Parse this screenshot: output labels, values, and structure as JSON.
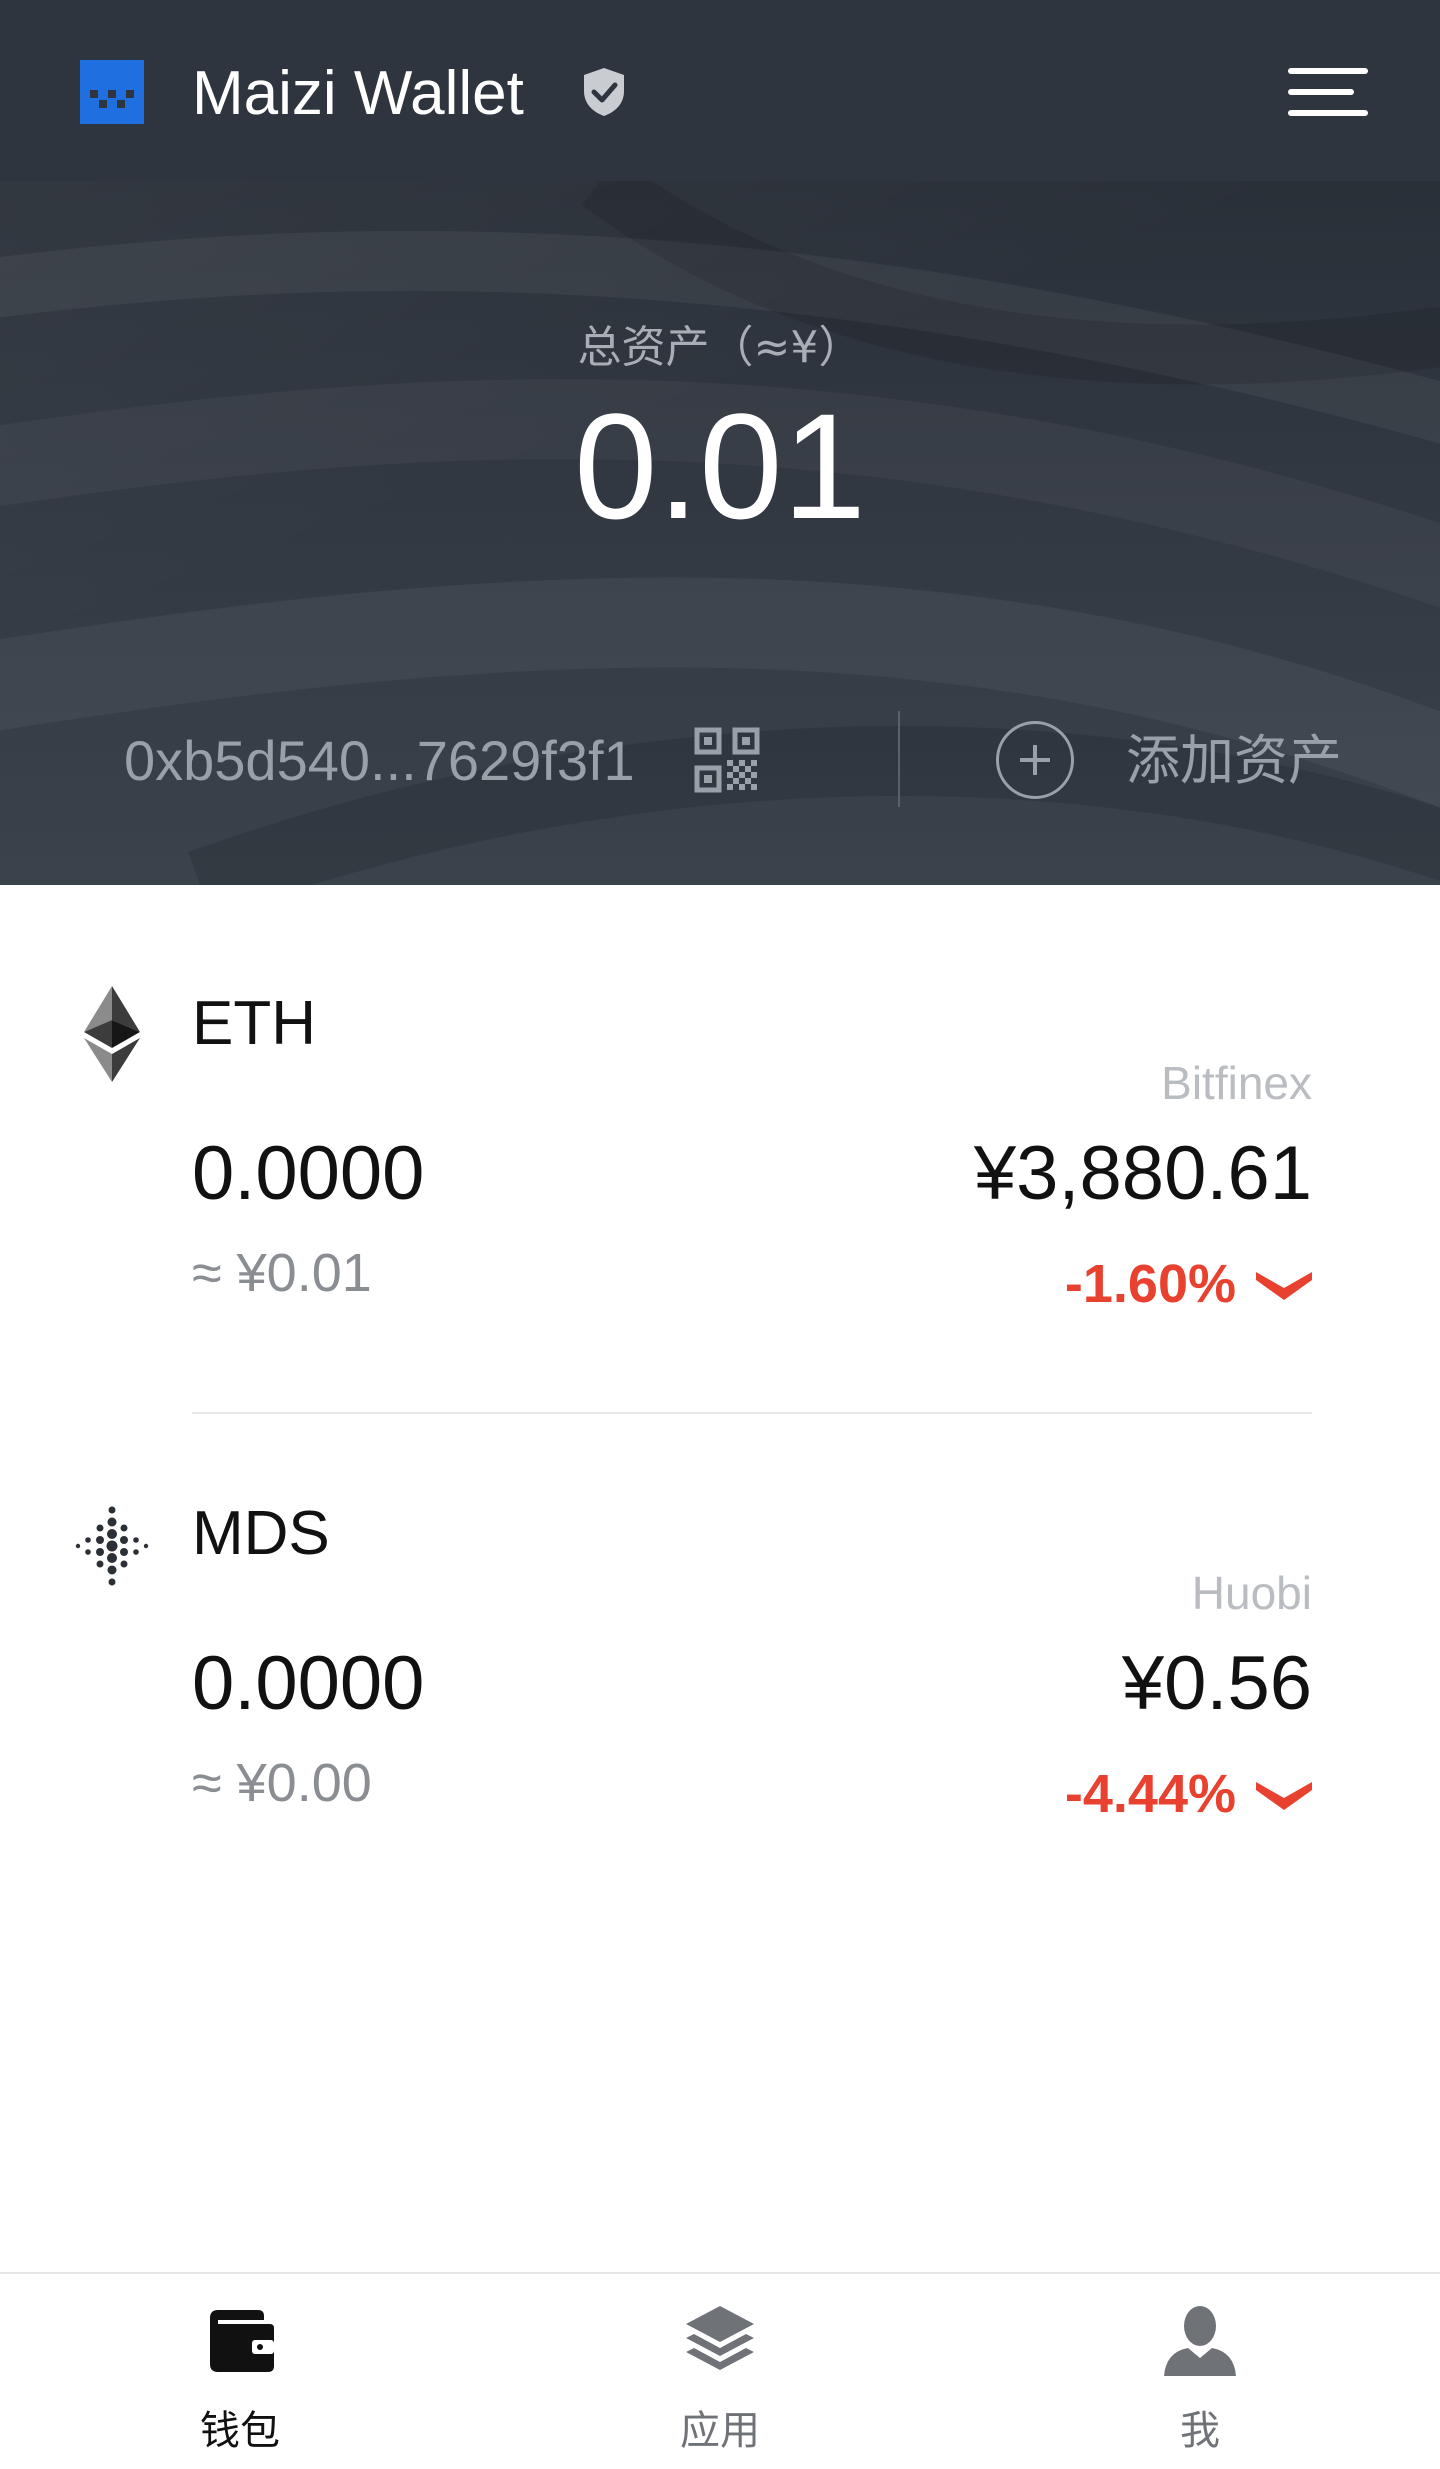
{
  "header": {
    "logo_icon": "maizi-logo-icon",
    "title": "Maizi Wallet",
    "verified_icon": "shield-check-icon",
    "menu_icon": "hamburger-menu-icon"
  },
  "hero": {
    "total_label": "总资产（≈¥）",
    "total_value": "0.01",
    "address": "0xb5d540...7629f3f1",
    "qr_icon": "qr-code-icon",
    "add_icon": "plus-circle-icon",
    "add_label": "添加资产"
  },
  "assets": [
    {
      "icon": "ethereum-icon",
      "name": "ETH",
      "exchange": "Bitfinex",
      "balance": "0.0000",
      "balance_cny": "≈ ¥0.01",
      "price": "¥3,880.61",
      "change": "-1.60%",
      "change_icon": "chevron-down-icon"
    },
    {
      "icon": "mds-dots-icon",
      "name": "MDS",
      "exchange": "Huobi",
      "balance": "0.0000",
      "balance_cny": "≈ ¥0.00",
      "price": "¥0.56",
      "change": "-4.44%",
      "change_icon": "chevron-down-icon"
    }
  ],
  "bottom_nav": {
    "items": [
      {
        "icon": "wallet-icon",
        "label": "钱包",
        "active": true
      },
      {
        "icon": "layers-icon",
        "label": "应用",
        "active": false
      },
      {
        "icon": "user-icon",
        "label": "我",
        "active": false
      }
    ]
  },
  "colors": {
    "header_bg": "#2e353f",
    "negative": "#e8412f",
    "brand_blue": "#1f6fe0",
    "text_primary": "#111111",
    "text_muted": "#8a8d92"
  }
}
